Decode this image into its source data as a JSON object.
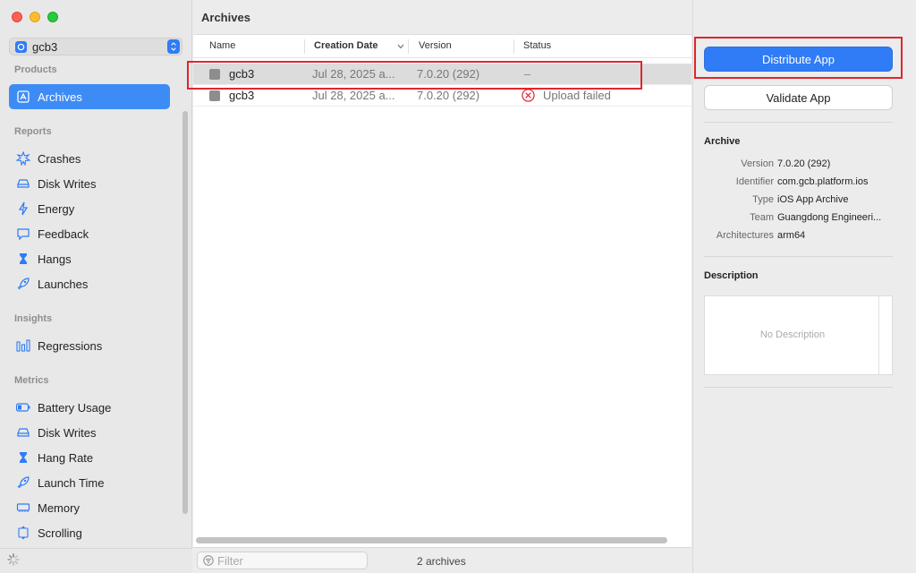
{
  "sidebar": {
    "app_selector": "gcb3",
    "sections": {
      "products": "Products",
      "reports": "Reports",
      "insights": "Insights",
      "metrics": "Metrics"
    },
    "items": {
      "archives": "Archives",
      "crashes": "Crashes",
      "disk_writes": "Disk Writes",
      "energy": "Energy",
      "feedback": "Feedback",
      "hangs": "Hangs",
      "launches": "Launches",
      "regressions": "Regressions",
      "battery_usage": "Battery Usage",
      "disk_writes_metric": "Disk Writes",
      "hang_rate": "Hang Rate",
      "launch_time": "Launch Time",
      "memory": "Memory",
      "scrolling": "Scrolling"
    }
  },
  "main": {
    "title": "Archives",
    "columns": {
      "name": "Name",
      "creation_date": "Creation Date",
      "version": "Version",
      "status": "Status"
    },
    "rows": [
      {
        "name": "gcb3",
        "date": "Jul 28, 2025 a...",
        "version": "7.0.20 (292)",
        "status": "–"
      },
      {
        "name": "gcb3",
        "date": "Jul 28, 2025 a...",
        "version": "7.0.20 (292)",
        "status": "Upload failed"
      }
    ],
    "filter_placeholder": "Filter",
    "count": "2 archives"
  },
  "inspector": {
    "distribute_label": "Distribute App",
    "validate_label": "Validate App",
    "archive_title": "Archive",
    "fields": [
      {
        "key": "Version",
        "value": "7.0.20 (292)"
      },
      {
        "key": "Identifier",
        "value": "com.gcb.platform.ios"
      },
      {
        "key": "Type",
        "value": "iOS App Archive"
      },
      {
        "key": "Team",
        "value": "Guangdong Engineeri..."
      },
      {
        "key": "Architectures",
        "value": "arm64"
      }
    ],
    "description_title": "Description",
    "description_placeholder": "No Description"
  },
  "colors": {
    "accent": "#2f7cf6",
    "selection": "#3d8cf5",
    "highlight": "#e0262d",
    "error": "#e0262d"
  }
}
